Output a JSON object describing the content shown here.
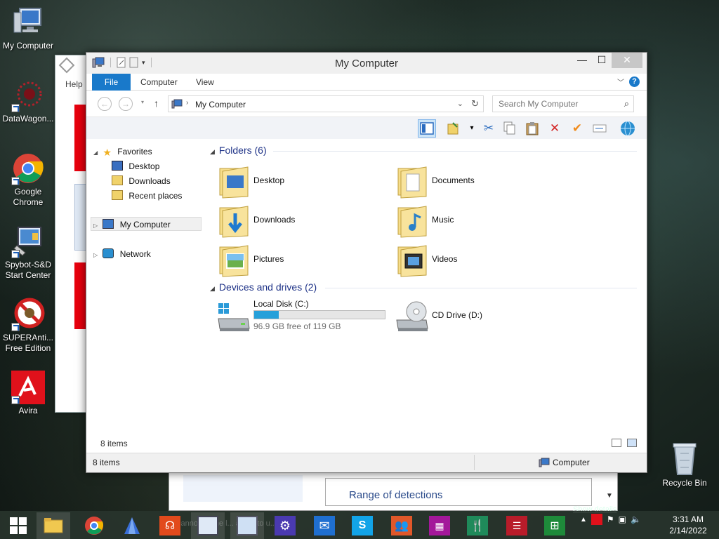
{
  "desktop": {
    "icons": [
      {
        "label": "My Computer"
      },
      {
        "label": "DataWagon..."
      },
      {
        "label": "Google Chrome"
      },
      {
        "label": "Spybot-S&D Start Center"
      },
      {
        "label": "SUPERAnti... Free Edition"
      },
      {
        "label": "Avira"
      }
    ],
    "recycle_bin": "Recycle Bin"
  },
  "background_window": {
    "help_label": "Help",
    "range_text": "Range of detections",
    "show_details": "Show details",
    "ghost_text": "cannot... gine l... and... to u..."
  },
  "explorer": {
    "title": "My Computer",
    "ribbon_tabs": {
      "file": "File",
      "computer": "Computer",
      "view": "View"
    },
    "help_button": "?",
    "address": "My Computer",
    "search_placeholder": "Search My Computer",
    "nav_pane": {
      "favorites": "Favorites",
      "desktop": "Desktop",
      "downloads": "Downloads",
      "recent_places": "Recent places",
      "my_computer": "My Computer",
      "network": "Network"
    },
    "folders_header": "Folders (6)",
    "folders": [
      {
        "name": "Desktop"
      },
      {
        "name": "Documents"
      },
      {
        "name": "Downloads"
      },
      {
        "name": "Music"
      },
      {
        "name": "Pictures"
      },
      {
        "name": "Videos"
      }
    ],
    "devices_header": "Devices and drives (2)",
    "drives": {
      "local": {
        "name": "Local Disk (C:)",
        "free": "96.9 GB free of 119 GB",
        "used_fraction": 0.19
      },
      "cd": {
        "name": "CD Drive (D:)"
      }
    },
    "status_inner": "8 items",
    "status_left": "8 items",
    "status_right": "Computer"
  },
  "taskbar": {
    "clock_time": "3:31 AM",
    "clock_date": "2/14/2022"
  },
  "colors": {
    "accent": "#1979ca",
    "drive_fill": "#26a0da",
    "group_header": "#1e3287"
  }
}
